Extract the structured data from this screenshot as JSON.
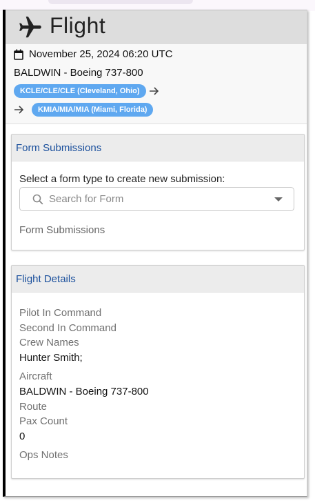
{
  "app": {
    "title": "Flight",
    "plane_icon": "airplane-icon"
  },
  "flight": {
    "datetime": "November 25, 2024 06:20 UTC",
    "aircraft_line": "BALDWIN - Boeing 737-800",
    "origin_chip": "KCLE/CLE/CLE (Cleveland, Ohio)",
    "destination_chip": "KMIA/MIA/MIA (Miami, Florida)"
  },
  "forms": {
    "header": "Form Submissions",
    "prompt": "Select a form type to create new submission:",
    "search_placeholder": "Search for Form",
    "submissions_label": "Form Submissions"
  },
  "details": {
    "header": "Flight Details",
    "pic_label": "Pilot In Command",
    "sic_label": "Second In Command",
    "crew_label": "Crew Names",
    "crew_value": "Hunter Smith;",
    "aircraft_label": "Aircraft",
    "aircraft_value": "BALDWIN - Boeing 737-800",
    "route_label": "Route",
    "pax_label": "Pax Count",
    "pax_value": "0",
    "ops_label": "Ops Notes"
  },
  "colors": {
    "chip": "#5fa8f0",
    "card_header_text": "#1a4f9c",
    "header_bg": "#dddddd"
  }
}
